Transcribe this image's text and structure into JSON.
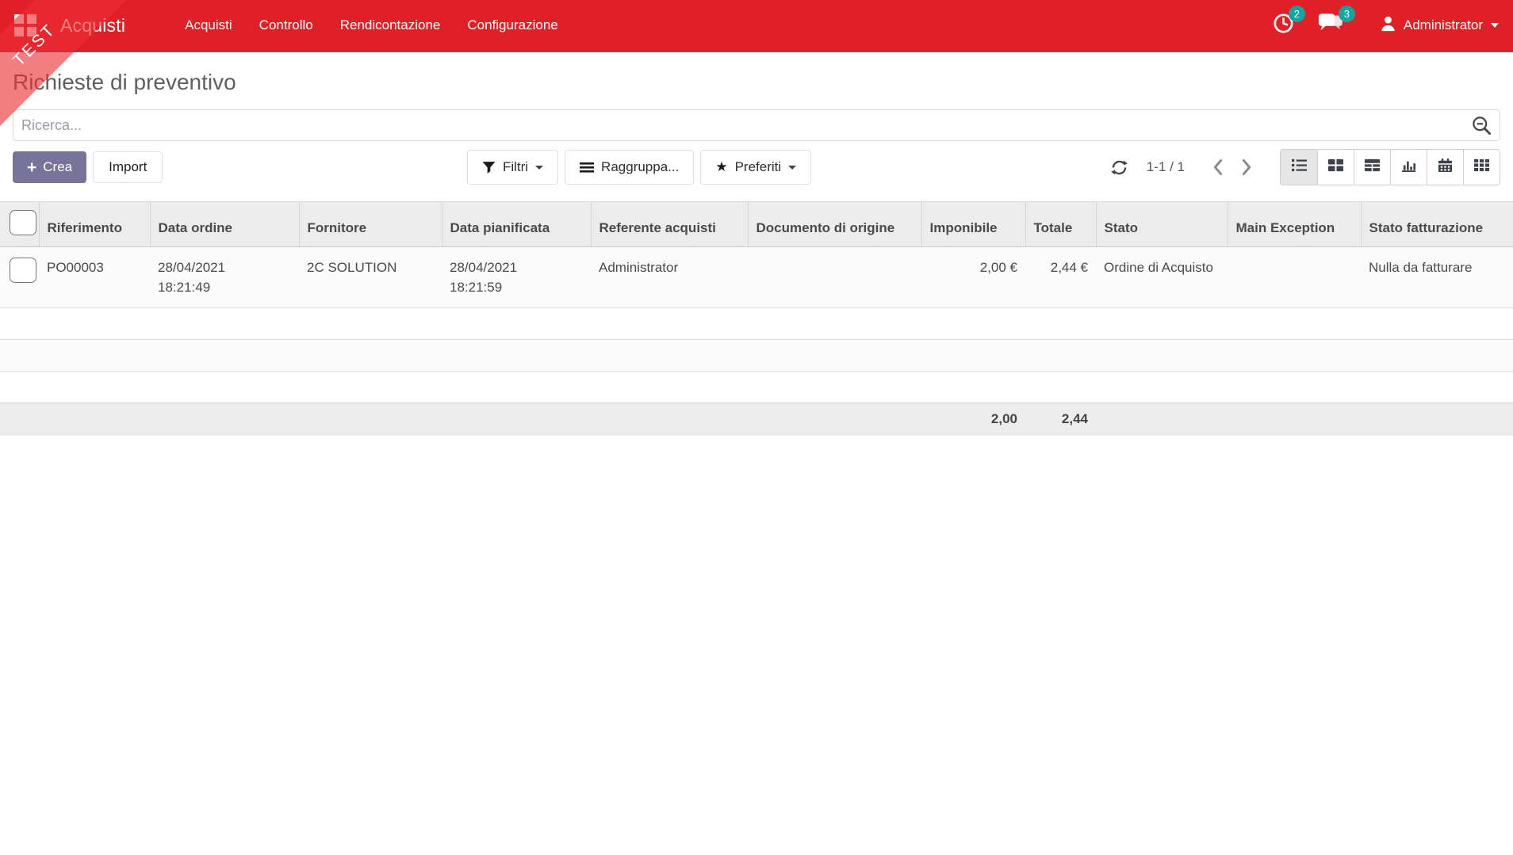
{
  "navbar": {
    "brand": "Acquisti",
    "menu_items": [
      "Acquisti",
      "Controllo",
      "Rendicontazione",
      "Configurazione"
    ],
    "activities_badge": "2",
    "messages_badge": "3",
    "user_name": "Administrator"
  },
  "ribbon": {
    "label": "TEST"
  },
  "page": {
    "title": "Richieste di preventivo"
  },
  "search": {
    "placeholder": "Ricerca..."
  },
  "icons": {
    "create_plus": "+",
    "favorites_star": "★"
  },
  "actions": {
    "create_label": "Crea",
    "import_label": "Import"
  },
  "filters": {
    "filters_label": "Filtri",
    "groupby_label": "Raggruppa...",
    "favorites_label": "Preferiti"
  },
  "pager": {
    "range": "1-1 / 1"
  },
  "colors": {
    "navbar_bg": "#df2026",
    "ribbon": "rgba(235,45,52,0.62)",
    "primary_button": "#787399",
    "badge": "#12a5a0",
    "active_view_bg": "#e6e6e6"
  },
  "table": {
    "columns": [
      "Riferimento",
      "Data ordine",
      "Fornitore",
      "Data pianificata",
      "Referente acquisti",
      "Documento di origine",
      "Imponibile",
      "Totale",
      "Stato",
      "Main Exception",
      "Stato fatturazione"
    ],
    "rows": [
      {
        "riferimento": "PO00003",
        "data_ordine": "28/04/2021 18:21:49",
        "fornitore": "2C SOLUTION",
        "data_pianificata": "28/04/2021 18:21:59",
        "referente": "Administrator",
        "documento_origine": "",
        "imponibile": "2,00 €",
        "totale": "2,44 €",
        "stato": "Ordine di Acquisto",
        "main_exception": "",
        "stato_fatturazione": "Nulla da fatturare"
      }
    ],
    "footer": {
      "imponibile_sum": "2,00",
      "totale_sum": "2,44"
    }
  }
}
